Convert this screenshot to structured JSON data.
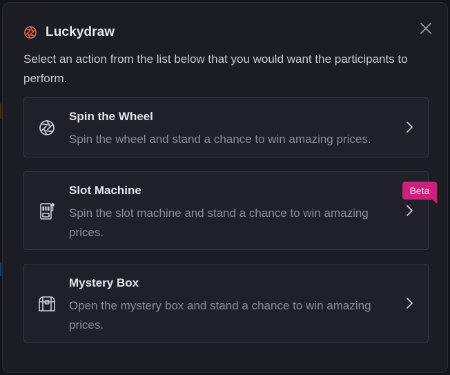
{
  "modal": {
    "title": "Luckydraw",
    "subtitle": "Select an action from the list below that you would want the participants to perform.",
    "close_icon": "close-icon",
    "brand_icon": "aperture-icon",
    "brand_color": "#e5643c"
  },
  "actions": [
    {
      "title": "Spin the Wheel",
      "description": "Spin the wheel and stand a chance to win amazing prices.",
      "icon": "wheel-icon"
    },
    {
      "title": "Slot Machine",
      "description": "Spin the slot machine and stand a chance to win amazing prices.",
      "icon": "slot-machine-icon",
      "badge": "Beta"
    },
    {
      "title": "Mystery Box",
      "description": "Open the mystery box and stand a chance to win amazing prices.",
      "icon": "treasure-chest-icon"
    }
  ],
  "colors": {
    "badge": "#c8227d",
    "background": "#1b1c24",
    "card": "#1f2029"
  }
}
